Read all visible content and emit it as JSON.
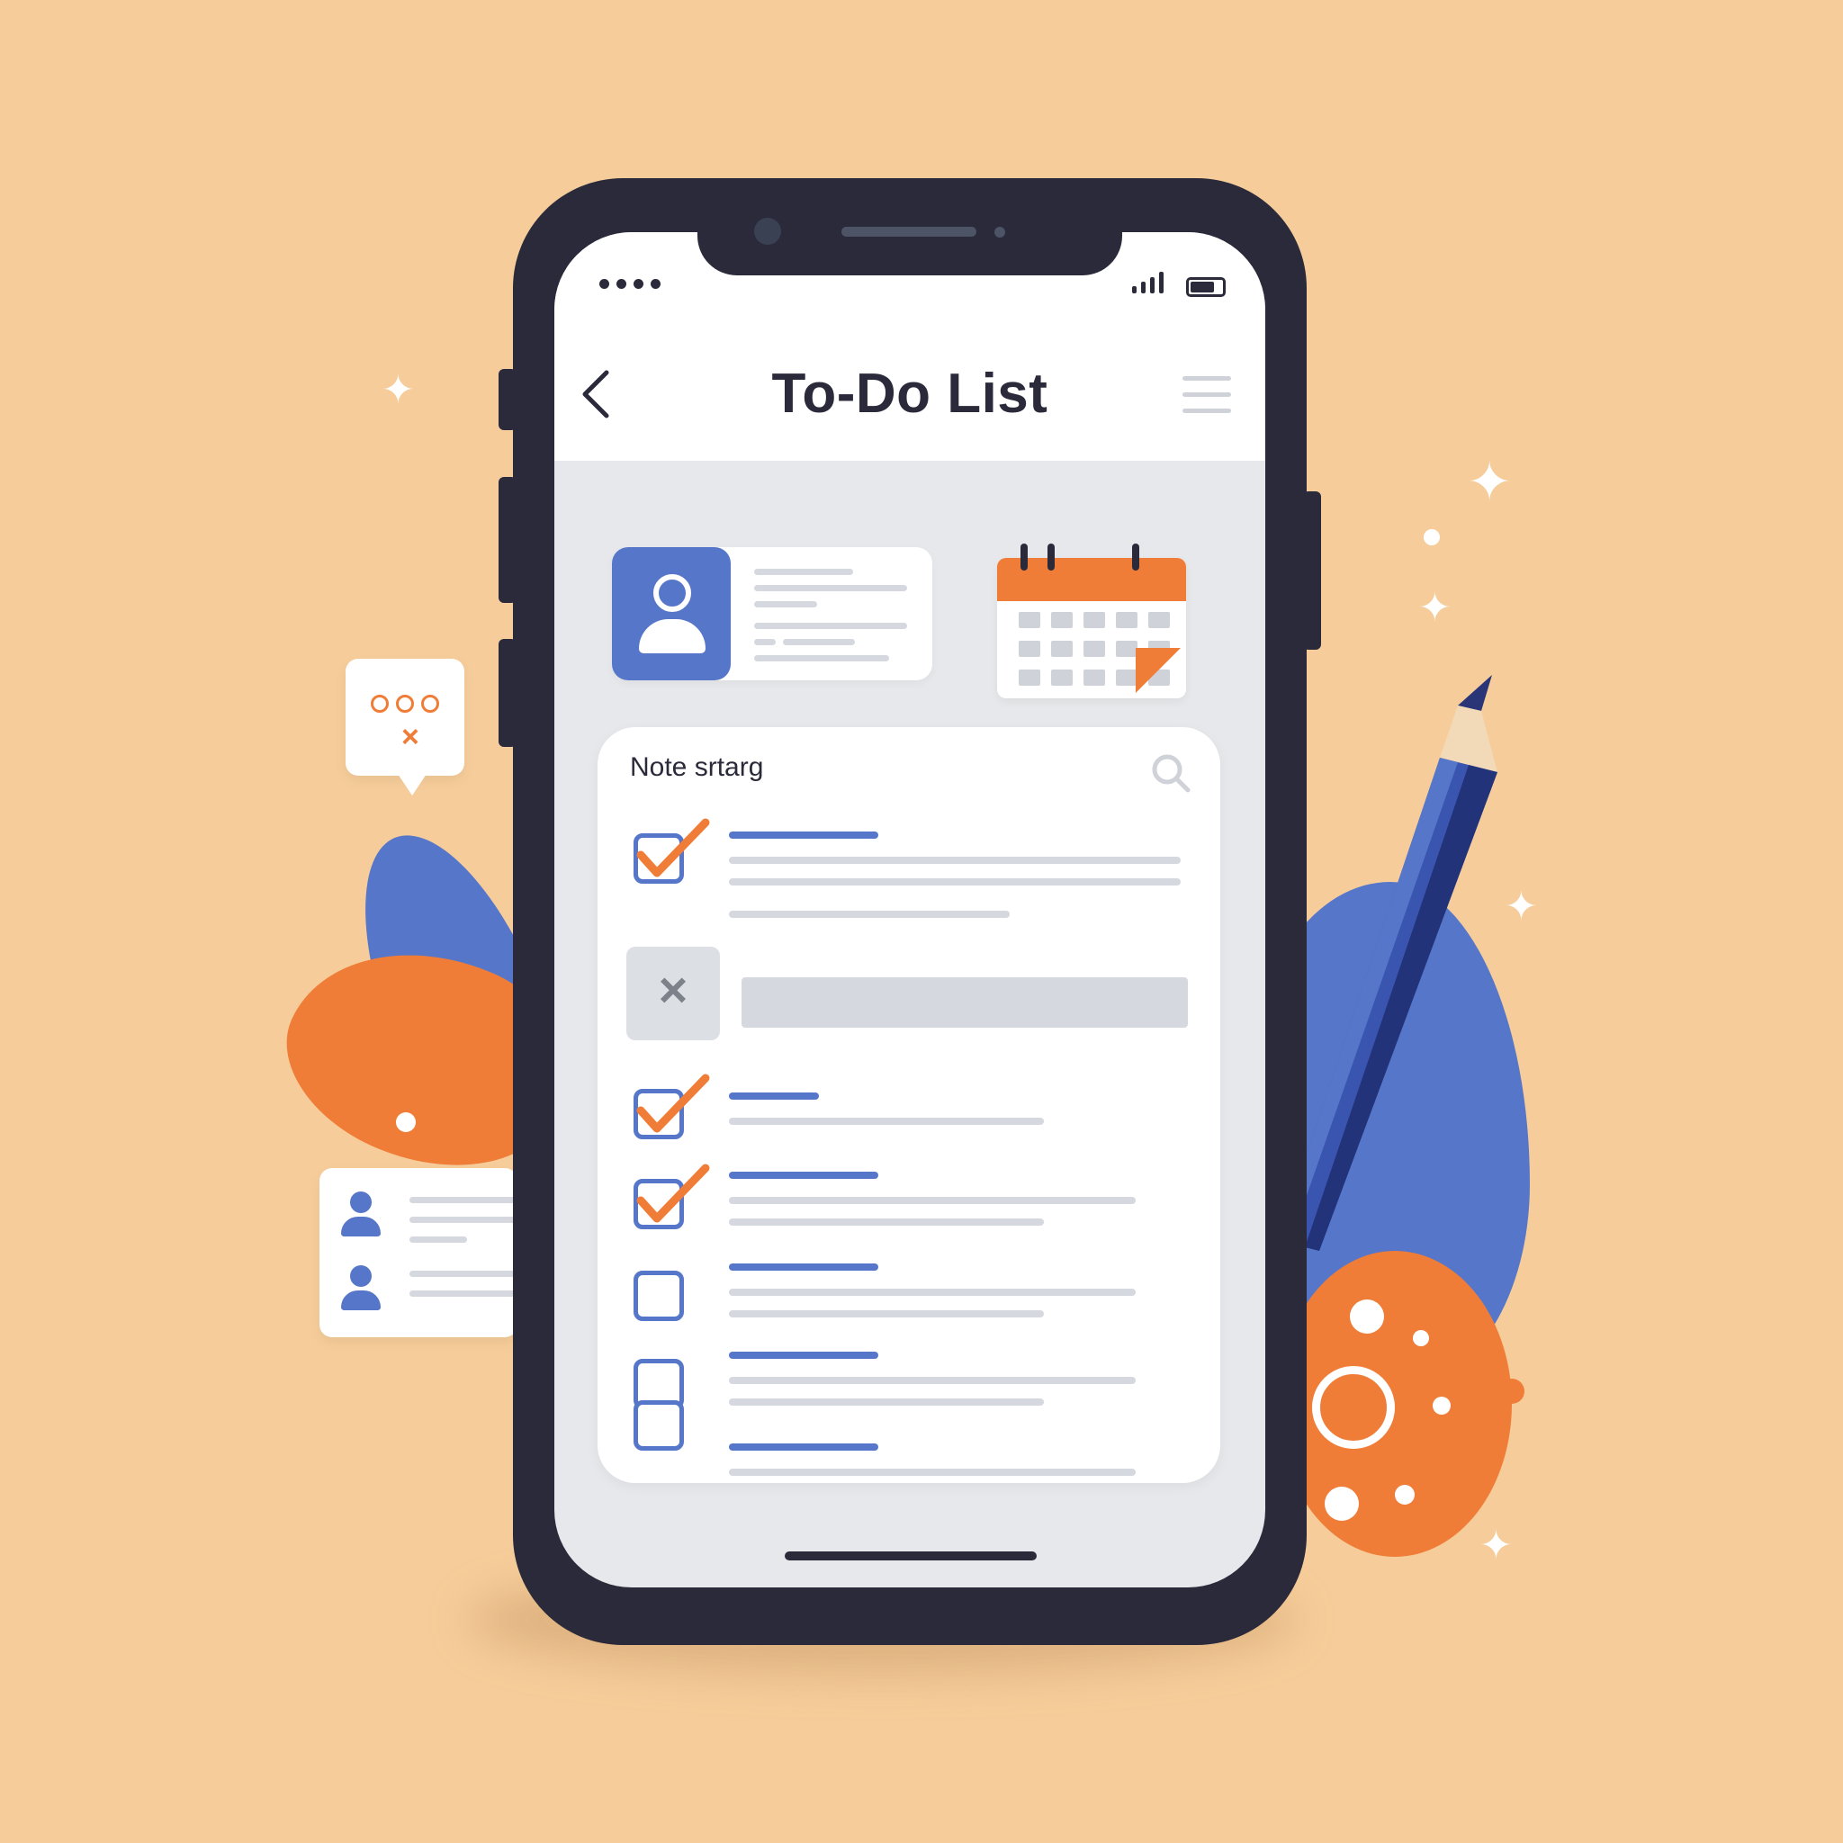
{
  "colors": {
    "background": "#f6cd9a",
    "accent_blue": "#5677c9",
    "accent_orange": "#f07d37",
    "phone_frame": "#2b2a3a",
    "screen_bg": "#e6e8eb"
  },
  "app": {
    "title": "To-Do List",
    "back_icon": "chevron-left-icon",
    "menu_icon": "hamburger-menu-icon"
  },
  "status_bar": {
    "signal_icon": "cellular-signal-icon",
    "battery_icon": "battery-icon",
    "battery_level": 0.75
  },
  "task_card": {
    "title": "Note srtarg",
    "search_icon": "search-icon",
    "tasks": [
      {
        "checked": true
      },
      {
        "dismissed": true
      },
      {
        "checked": true
      },
      {
        "checked": true
      },
      {
        "checked": false
      },
      {
        "checked": false
      },
      {
        "checked": false
      }
    ]
  },
  "decorations": {
    "icons": [
      "profile-card-icon",
      "calendar-icon",
      "chat-bubble-icon",
      "contacts-icon",
      "pencil-icon"
    ]
  }
}
